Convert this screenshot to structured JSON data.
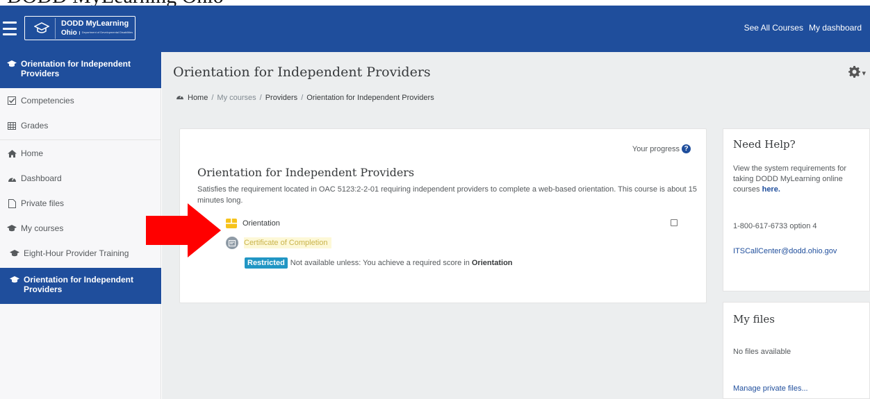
{
  "top_caption": "DODD MyLearning Ohio",
  "navbar": {
    "logo_title": "DODD MyLearning",
    "logo_state": "Ohio",
    "logo_dept": "Department of Developmental Disabilities",
    "links": [
      "See All Courses",
      "My dashboard"
    ],
    "color": "#1f4e9c"
  },
  "sidebar": {
    "items": [
      {
        "label": "Orientation for Independent Providers",
        "icon": "graduation-cap-icon",
        "active": true
      },
      {
        "label": "Competencies",
        "icon": "checkbox-icon"
      },
      {
        "label": "Grades",
        "icon": "table-icon"
      },
      {
        "label": "Home",
        "icon": "home-icon"
      },
      {
        "label": "Dashboard",
        "icon": "dashboard-icon"
      },
      {
        "label": "Private files",
        "icon": "file-icon"
      },
      {
        "label": "My courses",
        "icon": "graduation-cap-icon"
      },
      {
        "label": "Eight-Hour Provider Training",
        "icon": "graduation-cap-icon"
      },
      {
        "label": "Orientation for Independent Providers",
        "icon": "graduation-cap-icon",
        "active": true
      }
    ]
  },
  "page": {
    "title": "Orientation for Independent Providers",
    "breadcrumb": [
      "Home",
      "My courses",
      "Providers",
      "Orientation for Independent Providers"
    ]
  },
  "course": {
    "progress_label": "Your progress",
    "title": "Orientation for Independent Providers",
    "description": "Satisfies the requirement located in OAC 5123:2-2-01 requiring independent providers to complete a web-based orientation. This course is about 15 minutes long.",
    "activity": "Orientation",
    "certificate": "Certificate of Completion",
    "restricted_badge": "Restricted",
    "restricted_text": "Not available unless: You achieve a required score in",
    "restricted_target": "Orientation"
  },
  "help": {
    "title": "Need Help?",
    "text": "View the system requirements for taking DODD MyLearning online courses",
    "link": "here.",
    "phone": "1-800-617-6733 option 4",
    "email": "ITSCallCenter@dodd.ohio.gov"
  },
  "files": {
    "title": "My files",
    "empty": "No files available",
    "manage": "Manage private files..."
  }
}
